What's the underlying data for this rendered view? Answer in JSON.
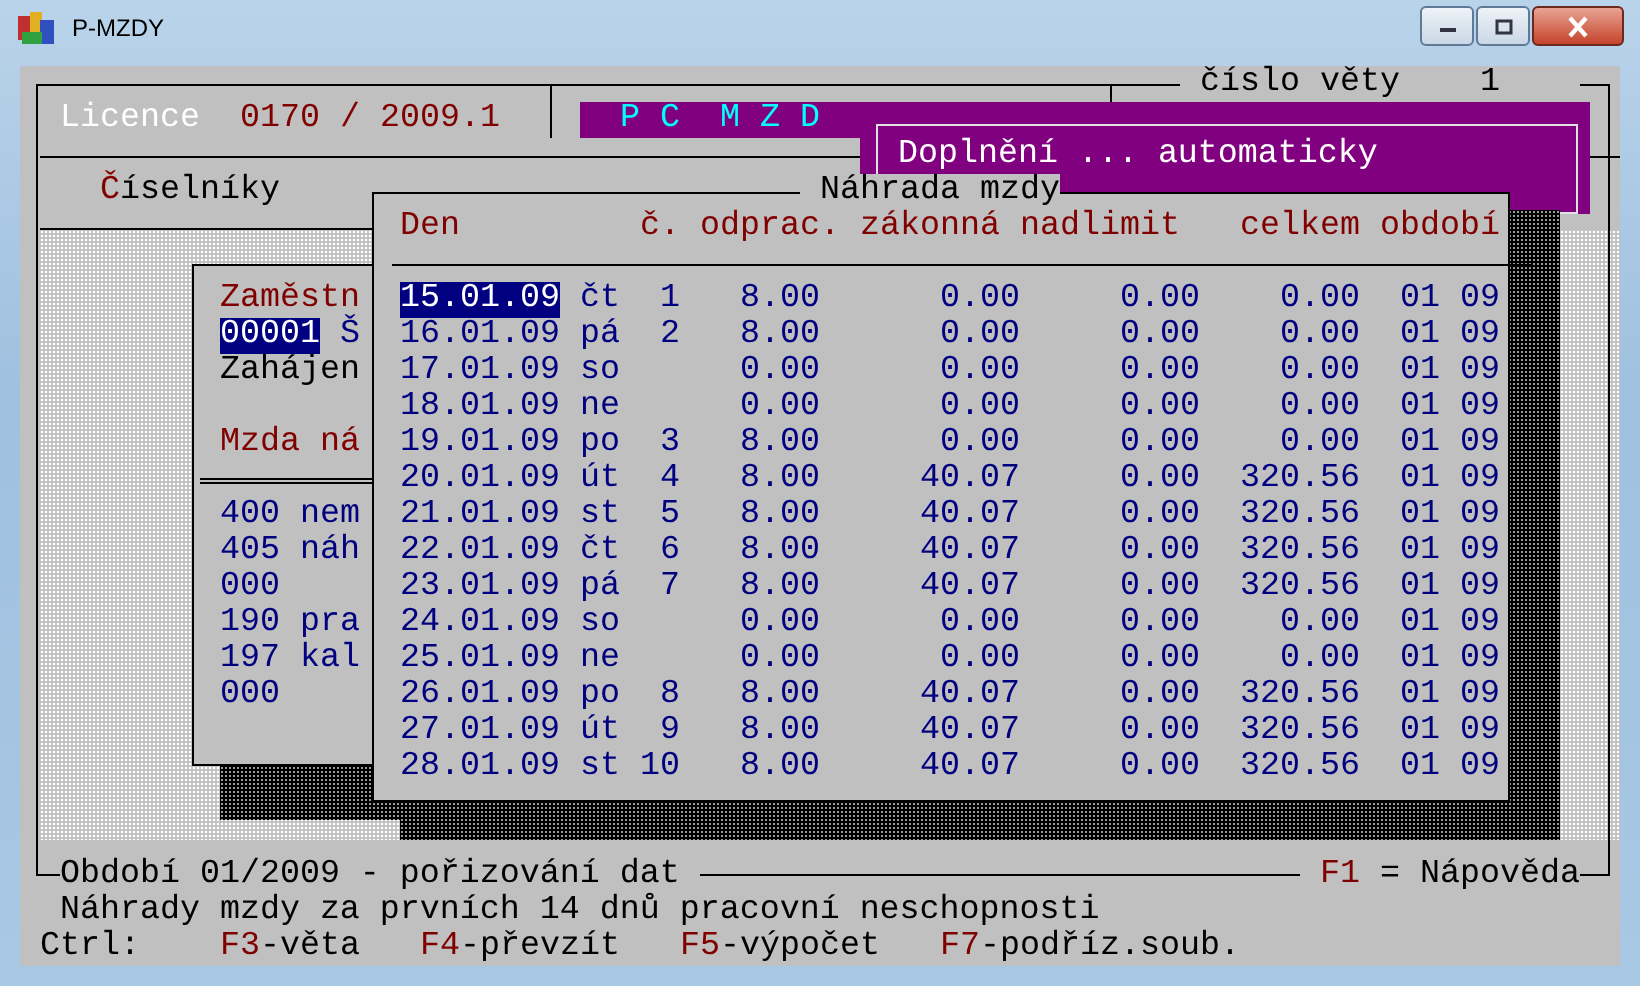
{
  "window": {
    "title": "P-MZDY"
  },
  "record_number": {
    "label": "číslo věty",
    "value": "1"
  },
  "licence": {
    "label": "Licence",
    "value": "0170 / 2009.1"
  },
  "banner": "P C  M Z D",
  "popup": {
    "text": "Doplnění ... automaticky"
  },
  "menu": [
    {
      "hotkey": "Č",
      "rest": "íselníky"
    }
  ],
  "employee_panel": {
    "lines": [
      {
        "kind": "heading",
        "text": "Zaměstn"
      },
      {
        "kind": "record",
        "code": "00001",
        "text": "Š"
      },
      {
        "kind": "plain",
        "text": "Zahájen"
      },
      {
        "kind": "gap"
      },
      {
        "kind": "heading",
        "text": "Mzda ná"
      }
    ],
    "items": [
      "400 nem",
      "405 náh",
      "000",
      "190 pra",
      "197 kal",
      "000"
    ]
  },
  "dialog": {
    "title": "Náhrada mzdy",
    "columns": [
      "Den",
      "č.",
      "odprac.",
      "zákonná",
      "nadlimit",
      "celkem",
      "období"
    ],
    "rows": [
      {
        "date": "15.01.09",
        "day": "čt",
        "number": "1",
        "worked": "8.00",
        "statutory": "0.00",
        "over_limit": "0.00",
        "total": "0.00",
        "period": "01 09",
        "selected": true
      },
      {
        "date": "16.01.09",
        "day": "pá",
        "number": "2",
        "worked": "8.00",
        "statutory": "0.00",
        "over_limit": "0.00",
        "total": "0.00",
        "period": "01 09",
        "selected": false
      },
      {
        "date": "17.01.09",
        "day": "so",
        "worked": "0.00",
        "statutory": "0.00",
        "over_limit": "0.00",
        "total": "0.00",
        "period": "01 09",
        "selected": false
      },
      {
        "date": "18.01.09",
        "day": "ne",
        "worked": "0.00",
        "statutory": "0.00",
        "over_limit": "0.00",
        "total": "0.00",
        "period": "01 09",
        "selected": false
      },
      {
        "date": "19.01.09",
        "day": "po",
        "number": "3",
        "worked": "8.00",
        "statutory": "0.00",
        "over_limit": "0.00",
        "total": "0.00",
        "period": "01 09",
        "selected": false
      },
      {
        "date": "20.01.09",
        "day": "út",
        "number": "4",
        "worked": "8.00",
        "statutory": "40.07",
        "over_limit": "0.00",
        "total": "320.56",
        "period": "01 09",
        "selected": false
      },
      {
        "date": "21.01.09",
        "day": "st",
        "number": "5",
        "worked": "8.00",
        "statutory": "40.07",
        "over_limit": "0.00",
        "total": "320.56",
        "period": "01 09",
        "selected": false
      },
      {
        "date": "22.01.09",
        "day": "čt",
        "number": "6",
        "worked": "8.00",
        "statutory": "40.07",
        "over_limit": "0.00",
        "total": "320.56",
        "period": "01 09",
        "selected": false
      },
      {
        "date": "23.01.09",
        "day": "pá",
        "number": "7",
        "worked": "8.00",
        "statutory": "40.07",
        "over_limit": "0.00",
        "total": "320.56",
        "period": "01 09",
        "selected": false
      },
      {
        "date": "24.01.09",
        "day": "so",
        "worked": "0.00",
        "statutory": "0.00",
        "over_limit": "0.00",
        "total": "0.00",
        "period": "01 09",
        "selected": false
      },
      {
        "date": "25.01.09",
        "day": "ne",
        "worked": "0.00",
        "statutory": "0.00",
        "over_limit": "0.00",
        "total": "0.00",
        "period": "01 09",
        "selected": false
      },
      {
        "date": "26.01.09",
        "day": "po",
        "number": "8",
        "worked": "8.00",
        "statutory": "40.07",
        "over_limit": "0.00",
        "total": "320.56",
        "period": "01 09",
        "selected": false
      },
      {
        "date": "27.01.09",
        "day": "út",
        "number": "9",
        "worked": "8.00",
        "statutory": "40.07",
        "over_limit": "0.00",
        "total": "320.56",
        "period": "01 09",
        "selected": false
      },
      {
        "date": "28.01.09",
        "day": "st",
        "number": "10",
        "worked": "8.00",
        "statutory": "40.07",
        "over_limit": "0.00",
        "total": "320.56",
        "period": "01 09",
        "selected": false
      }
    ]
  },
  "status_bar": {
    "text": "Období 01/2009 - pořizování dat",
    "help_key": "F1",
    "help_text": "= Nápověda"
  },
  "message": "Náhrady mzdy za prvních 14 dnů pracovní neschopnosti",
  "shortcuts": {
    "label": "Ctrl:",
    "items": [
      {
        "key": "F3",
        "label": "-věta"
      },
      {
        "key": "F4",
        "label": "-převzít"
      },
      {
        "key": "F5",
        "label": "-výpočet"
      },
      {
        "key": "F7",
        "label": "-podříz.soub."
      }
    ]
  }
}
